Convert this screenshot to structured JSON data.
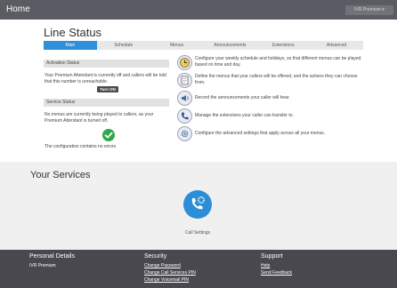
{
  "topbar": {
    "home": "Home",
    "user_menu": "IVR Premium ▾"
  },
  "page_title": "Line Status",
  "tabs": [
    "Main",
    "Schedule",
    "Menus",
    "Announcements",
    "Extensions",
    "Advanced"
  ],
  "activation": {
    "heading": "Activation Status",
    "text": "Your Premium Attendant is currently off and callers will be told that this number is unreachable.",
    "button": "Turn ON"
  },
  "service": {
    "heading": "Service Status",
    "text": "No menus are currently being played to callers, as your Premium Attendant is turned off.",
    "ok_text": "The configuration contains no errors."
  },
  "features": [
    {
      "icon": "clock-icon",
      "text": "Configure your weekly schedule and holidays, so that different menus can be played based on time and day."
    },
    {
      "icon": "menu-document-icon",
      "text": "Define the menus that your callers will be offered, and the actions they can choose from."
    },
    {
      "icon": "announcement-icon",
      "text": "Record the announcements your caller will hear."
    },
    {
      "icon": "phone-icon",
      "text": "Manage the extensions your caller can transfer to."
    },
    {
      "icon": "advanced-settings-icon",
      "text": "Configure the advanced settings that apply across all your menus."
    }
  ],
  "services": {
    "title": "Your Services",
    "call_settings": "Call Settings"
  },
  "footer": {
    "personal": {
      "title": "Personal Details",
      "item": "IVR Premium"
    },
    "security": {
      "title": "Security",
      "links": [
        "Change Password",
        "Change Call Services PIN",
        "Change Voicemail PIN"
      ]
    },
    "support": {
      "title": "Support",
      "links": [
        "Help",
        "Send Feedback"
      ]
    }
  },
  "colors": {
    "accent": "#2f8fd8",
    "topbar": "#5b5b63",
    "footer": "#48484e",
    "ok": "#2ea84a"
  }
}
